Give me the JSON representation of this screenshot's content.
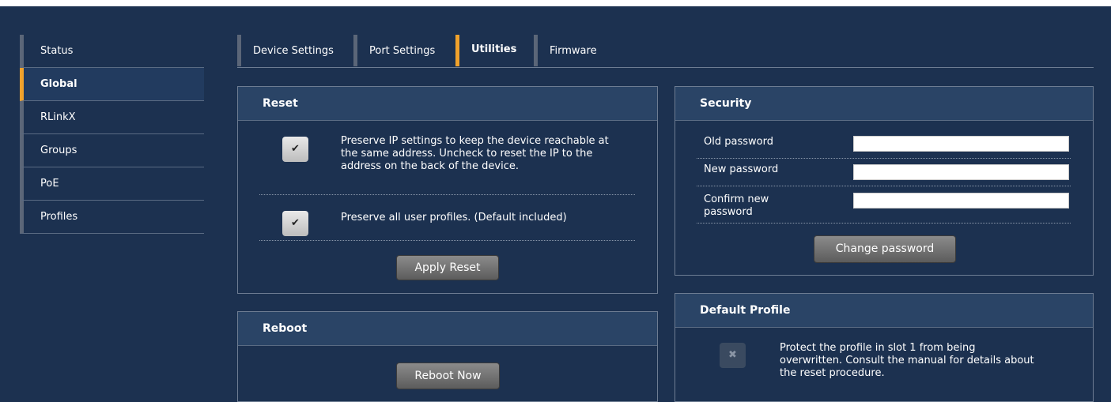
{
  "sidebar": {
    "items": [
      {
        "label": "Status"
      },
      {
        "label": "Global"
      },
      {
        "label": "RLinkX"
      },
      {
        "label": "Groups"
      },
      {
        "label": "PoE"
      },
      {
        "label": "Profiles"
      }
    ],
    "active": "Global"
  },
  "tabs": {
    "items": [
      {
        "label": "Device Settings"
      },
      {
        "label": "Port Settings"
      },
      {
        "label": "Utilities"
      },
      {
        "label": "Firmware"
      }
    ],
    "active": "Utilities"
  },
  "reset": {
    "title": "Reset",
    "options": [
      {
        "text": "Preserve IP settings to keep the device reachable at the same address. Uncheck to reset the IP to the address on the back of the device.",
        "checked": true
      },
      {
        "text": "Preserve all user profiles. (Default included)",
        "checked": true
      }
    ],
    "apply_label": "Apply Reset"
  },
  "reboot": {
    "title": "Reboot",
    "button_label": "Reboot Now"
  },
  "security": {
    "title": "Security",
    "old_password_label": "Old password",
    "new_password_label": "New password",
    "confirm_password_label": "Confirm new password",
    "old_password_value": "",
    "new_password_value": "",
    "confirm_password_value": "",
    "change_label": "Change password"
  },
  "default_profile": {
    "title": "Default Profile",
    "protect_text": "Protect the profile in slot 1 from being overwritten. Consult the manual for details about the reset procedure.",
    "checked": false
  },
  "icons": {
    "check": "checkmark-icon",
    "x": "x-icon"
  },
  "colors": {
    "background": "#1c3150",
    "accent": "#f0a22c",
    "panel_header": "#2a4466"
  }
}
